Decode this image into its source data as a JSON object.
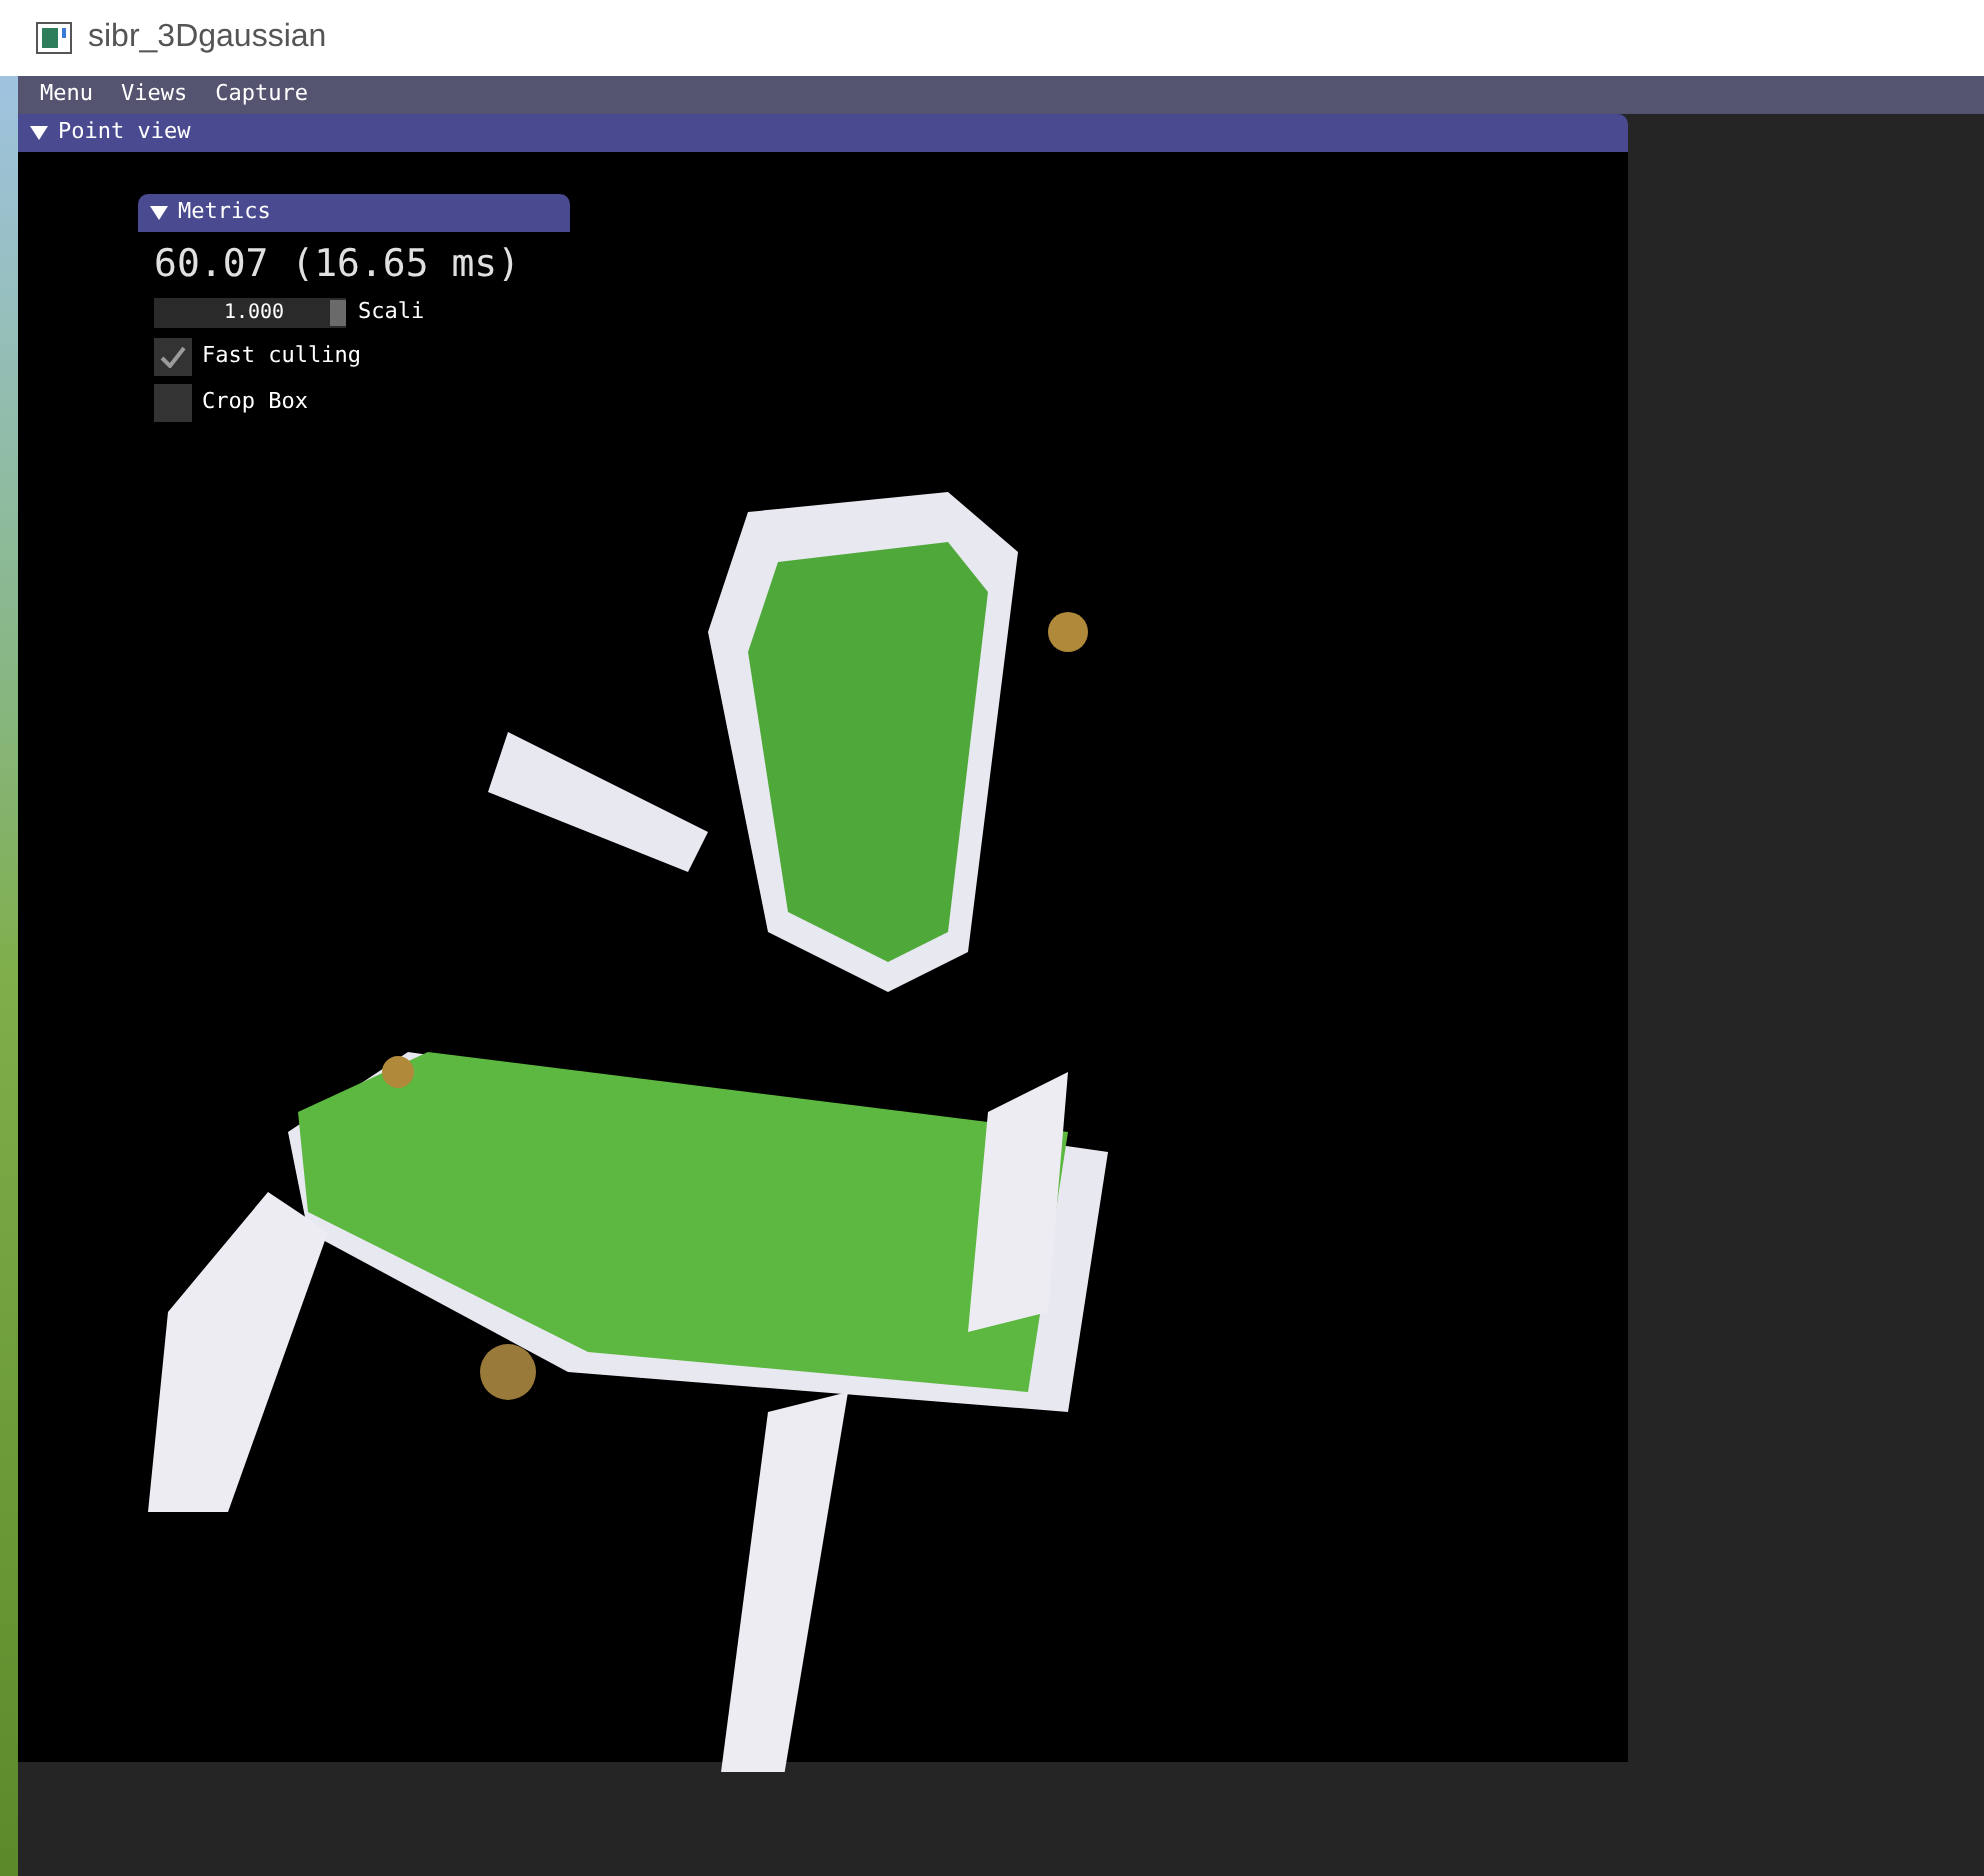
{
  "window": {
    "title": "sibr_3Dgaussian"
  },
  "menu_bar": [
    "Menu",
    "Views",
    "Capture"
  ],
  "point_view": {
    "title": "Point view",
    "expanded": true
  },
  "metrics": {
    "title": "Metrics",
    "expanded": true,
    "fps": "60.07 (16.65 ms)",
    "slider": {
      "value": "1.000",
      "label": "Scali",
      "level": 1
    },
    "checkboxes": [
      {
        "label": "Fast culling",
        "checked": true
      },
      {
        "label": "Crop Box",
        "checked": false
      }
    ]
  }
}
